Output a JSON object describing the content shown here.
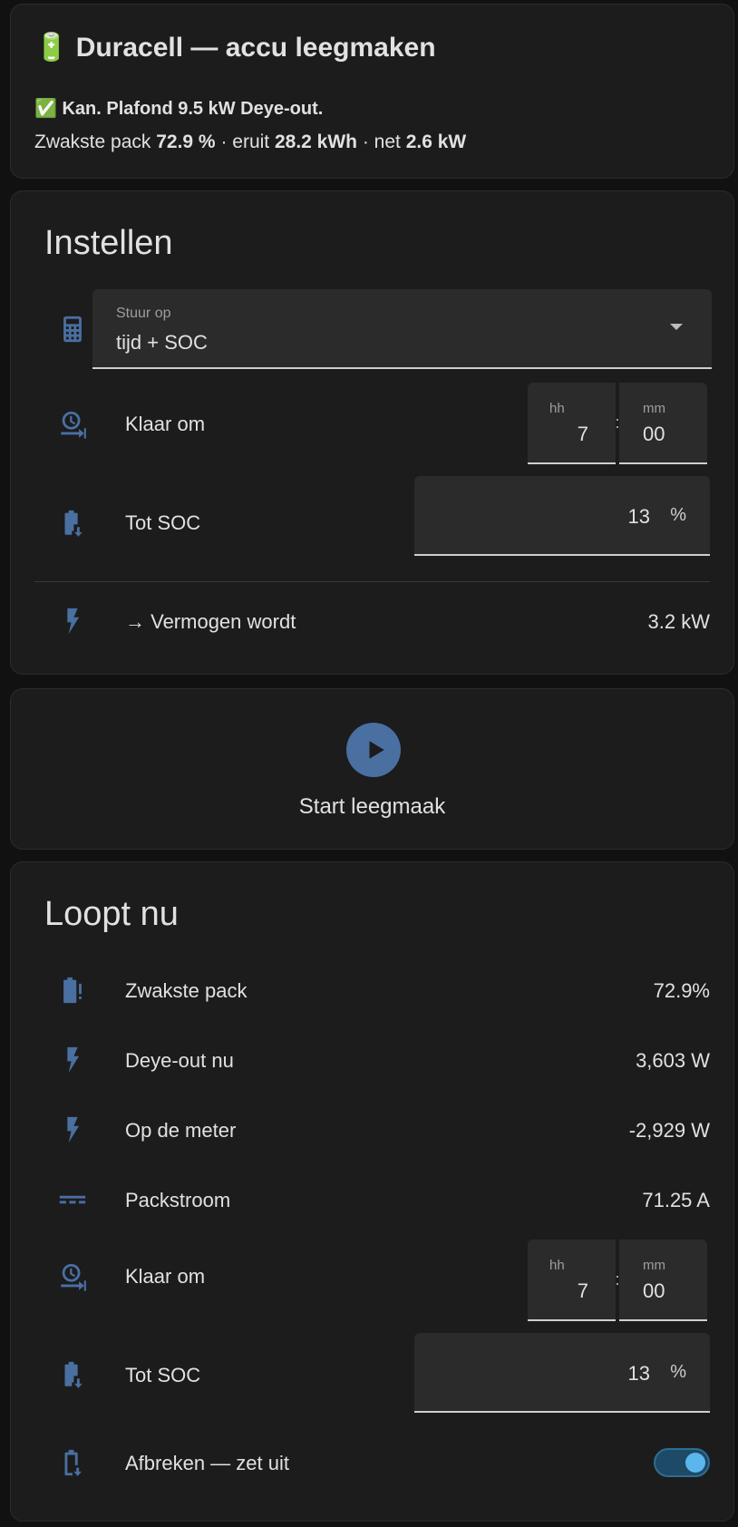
{
  "header": {
    "title": "🔋 Duracell — accu leegmaken",
    "status_line": "✅ Kan. Plafond 9.5 kW Deye-out.",
    "summary": {
      "prefix": "Zwakste pack ",
      "pack": "72.9 %",
      "sep1": " · eruit ",
      "kwh": "28.2 kWh",
      "sep2": " · net ",
      "net": "2.6 kW"
    }
  },
  "instellen": {
    "title": "Instellen",
    "stuur_op": {
      "label": "Stuur op",
      "value": "tijd + SOC",
      "icon": "calculator-icon"
    },
    "klaar_om": {
      "label": "Klaar om",
      "hh_label": "hh",
      "mm_label": "mm",
      "hh": "7",
      "mm": "00",
      "sep": ":",
      "icon": "clock-arrow-icon"
    },
    "tot_soc": {
      "label": "Tot SOC",
      "value": "13",
      "unit": "%",
      "icon": "battery-down-icon"
    },
    "vermogen": {
      "label": "→ Vermogen wordt",
      "value": "3.2 kW",
      "icon": "flash-icon"
    }
  },
  "start": {
    "label": "Start leegmaak",
    "icon": "play-icon"
  },
  "loopt_nu": {
    "title": "Loopt nu",
    "rows": [
      {
        "label": "Zwakste pack",
        "value": "72.9%",
        "icon": "battery-alert-icon"
      },
      {
        "label": "Deye-out nu",
        "value": "3,603 W",
        "icon": "flash-icon"
      },
      {
        "label": "Op de meter",
        "value": "-2,929 W",
        "icon": "flash-icon"
      },
      {
        "label": "Packstroom",
        "value": "71.25 A",
        "icon": "current-dc-icon"
      }
    ],
    "klaar_om": {
      "label": "Klaar om",
      "hh_label": "hh",
      "mm_label": "mm",
      "hh": "7",
      "mm": "00",
      "sep": ":"
    },
    "tot_soc": {
      "label": "Tot SOC",
      "value": "13",
      "unit": "%"
    },
    "afbreken": {
      "label": "Afbreken — zet uit",
      "state": "on"
    }
  },
  "colors": {
    "accent_icon": "#4a6fa1",
    "toggle_on": "#5bb6ee",
    "card_bg": "#1c1c1c"
  }
}
